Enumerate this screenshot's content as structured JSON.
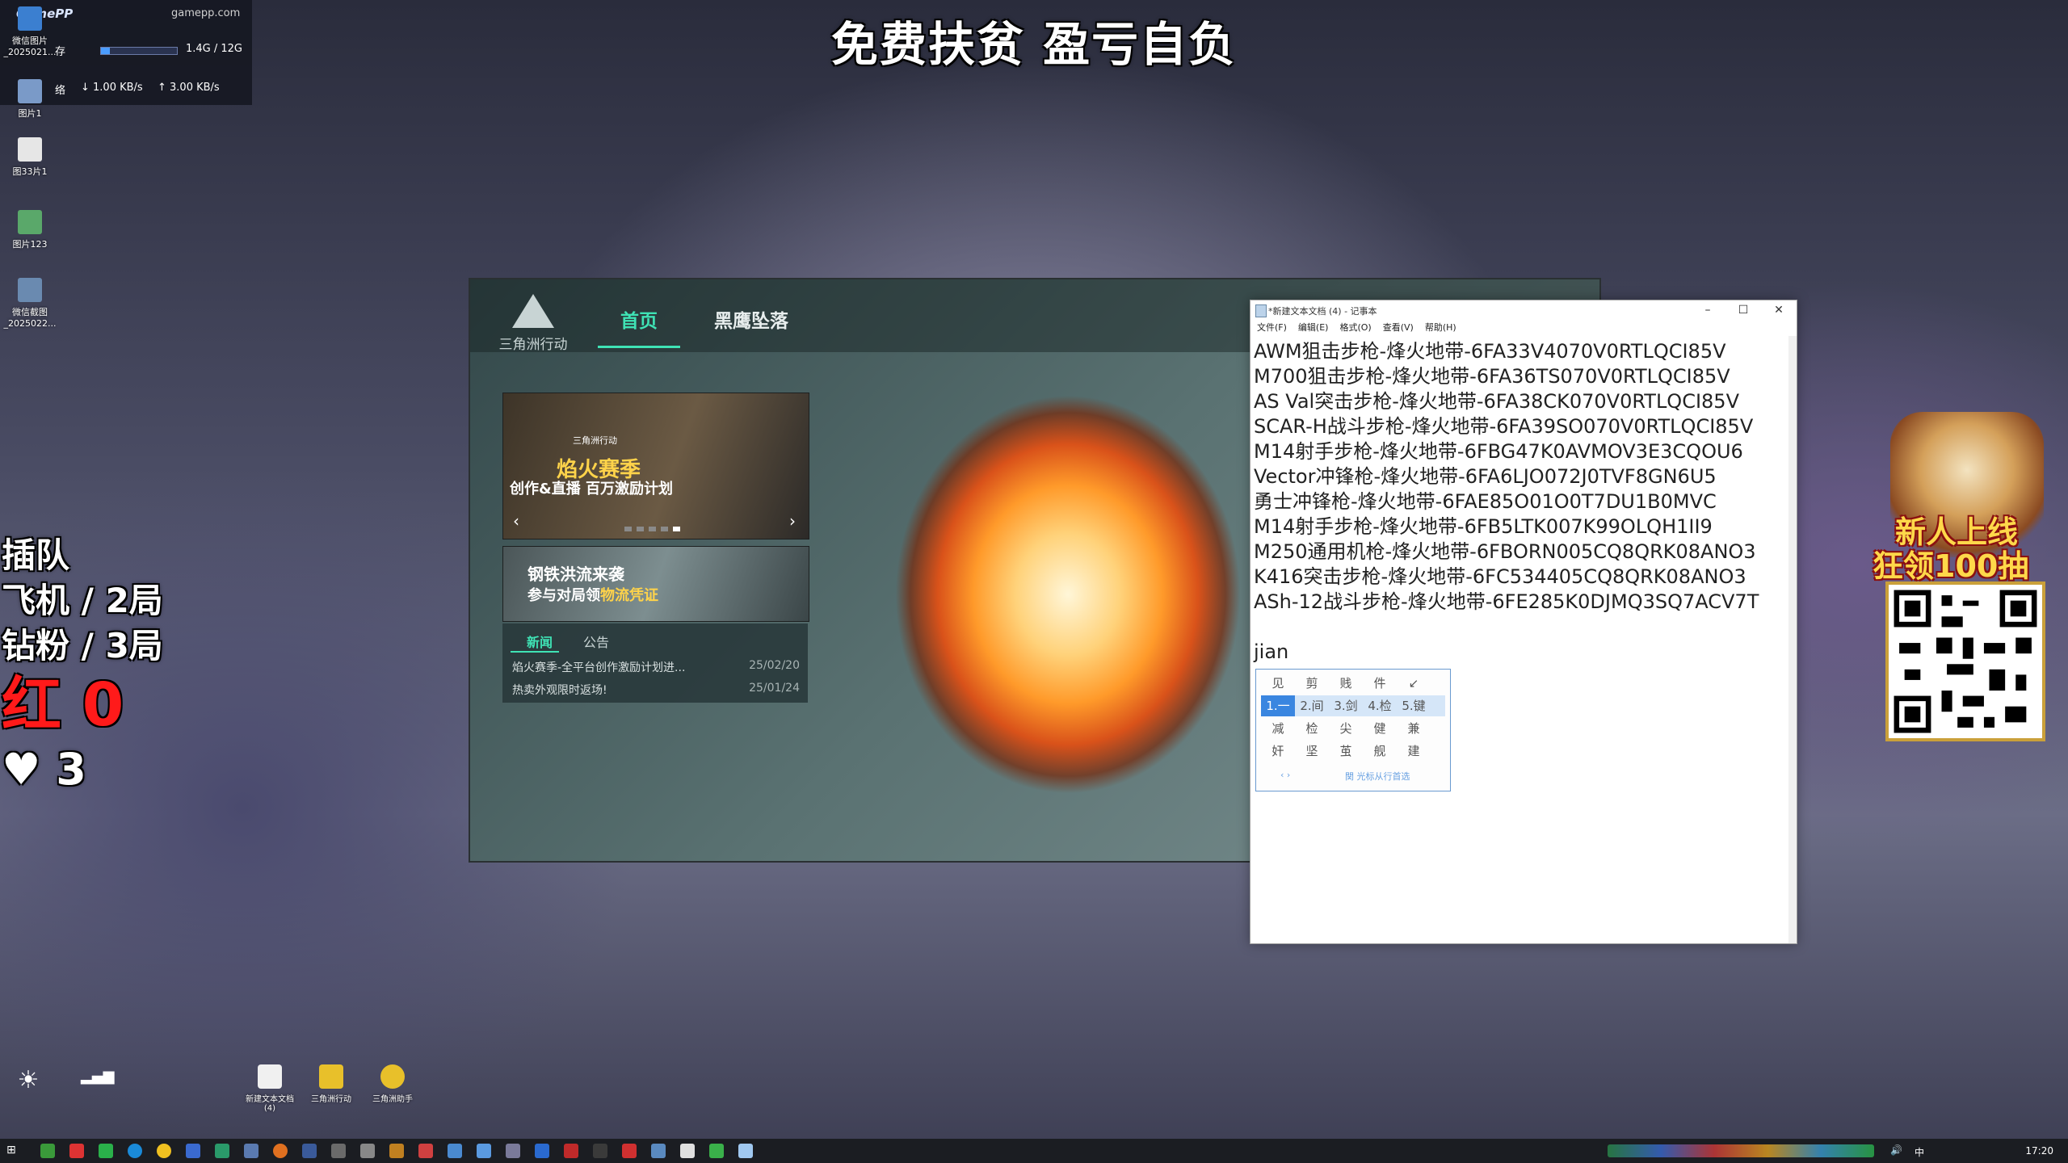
{
  "stream": {
    "banner": "免费扶贫 盈亏自负",
    "overlay_lines": [
      "插队",
      "飞机 / 2局",
      "钻粉 / 3局"
    ],
    "red_text": "红 0",
    "hearts": "3"
  },
  "gamepp": {
    "logo": "GamePP",
    "site": "gamepp.com",
    "mem_label": "存",
    "mem_value": "1.4G / 12G",
    "mem_progress": 0.12,
    "net_label": "络",
    "down": "1.00 KB/s",
    "up": "3.00 KB/s"
  },
  "desktop_icons": [
    {
      "label": "微信图片_2025021..."
    },
    {
      "label": "图片1"
    },
    {
      "label": "图33片1"
    },
    {
      "label": "图片123"
    },
    {
      "label": "微信截图_2025022..."
    }
  ],
  "launcher": {
    "logo": "三角洲行动",
    "tabs": [
      "首页",
      "黑鹰坠落"
    ],
    "carousel": {
      "title": "焰火赛季",
      "subtitle": "创作&直播 百万激励计划",
      "badge": "三角洲行动"
    },
    "promo": {
      "line1": "钢铁洪流来袭",
      "line2_a": "参与对局领",
      "line2_b": "物流凭证"
    },
    "news_tabs": [
      "新闻",
      "公告"
    ],
    "news": [
      {
        "title": "焰火赛季-全平台创作激励计划进...",
        "date": "25/02/20"
      },
      {
        "title": "热卖外观限时返场!",
        "date": "25/01/24"
      }
    ]
  },
  "notepad": {
    "title": "*新建文本文档 (4) - 记事本",
    "menu": [
      "文件(F)",
      "编辑(E)",
      "格式(O)",
      "查看(V)",
      "帮助(H)"
    ],
    "lines": [
      "AWM狙击步枪-烽火地带-6FA33V4070V0RTLQCI85V",
      "M700狙击步枪-烽火地带-6FA36TS070V0RTLQCI85V",
      "AS Val突击步枪-烽火地带-6FA38CK070V0RTLQCI85V",
      "SCAR-H战斗步枪-烽火地带-6FA39SO070V0RTLQCI85V",
      "M14射手步枪-烽火地带-6FBG47K0AVMOV3E3CQOU6",
      "Vector冲锋枪-烽火地带-6FA6LJO072J0TVF8GN6U5",
      "勇士冲锋枪-烽火地带-6FAE85O01O0T7DU1B0MVC",
      "M14射手步枪-烽火地带-6FB5LTK007K99OLQH1II9",
      "M250通用机枪-烽火地带-6FBORN005CQ8QRK08ANO3",
      "K416突击步枪-烽火地带-6FC534405CQ8QRK08ANO3",
      "ASh-12战斗步枪-烽火地带-6FE285K0DJMQ3SQ7ACV7T",
      "",
      "jian"
    ]
  },
  "ime": {
    "row1": [
      "见",
      "剪",
      "贱",
      "件",
      "↙"
    ],
    "row2": [
      "1.一",
      "2.间",
      "3.剑",
      "4.检",
      "5.键"
    ],
    "row3": [
      "减",
      "检",
      "尖",
      "健",
      "兼"
    ],
    "row4": [
      "奸",
      "坚",
      "茧",
      "舰",
      "建"
    ],
    "footer": "関 光标从行首选"
  },
  "ad": {
    "line1": "新人上线",
    "line2": "狂领100抽"
  },
  "dock_items": [
    {
      "label": "新建文本文档 (4)"
    },
    {
      "label": "三角洲行动"
    },
    {
      "label": "三角洲助手"
    }
  ],
  "taskbar": {
    "clock": "17:20"
  },
  "colors": {
    "accent": "#3fe3b5",
    "red": "#ff1a1a",
    "ime_highlight": "#3a86e0",
    "gold": "#ffd34a"
  }
}
